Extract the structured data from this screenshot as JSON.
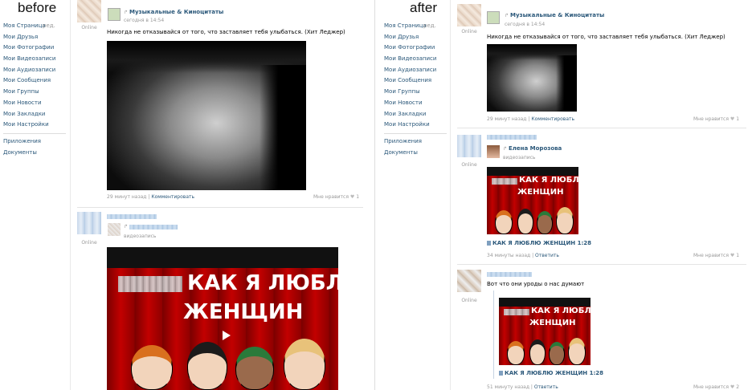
{
  "captions": {
    "before": "before",
    "after": "after"
  },
  "sidebar": {
    "items": [
      "Моя Страница",
      "Мои Друзья",
      "Мои Фотографии",
      "Мои Видеозаписи",
      "Мои Аудиозаписи",
      "Мои Сообщения",
      "Мои Группы",
      "Мои Новости",
      "Мои Закладки",
      "Мои Настройки"
    ],
    "edit": "ред.",
    "extra": [
      "Приложения",
      "Документы"
    ]
  },
  "before": {
    "post1": {
      "online": "Online",
      "group": "Музыкальные & Киноцитаты",
      "time": "сегодня в 14:54",
      "text": "Никогда не отказывайся от того, что заставляет тебя улыбаться. (Хит Леджер)",
      "footer_time": "29 минут назад",
      "footer_sep": " | ",
      "footer_link": "Комментировать",
      "likes": "Мне нравится",
      "likes_count": "1"
    },
    "post2": {
      "online": "Online",
      "sub": "видеозапись",
      "video_title1": "КАК Я ЛЮБЛЮ",
      "video_title2": "ЖЕНЩИН"
    }
  },
  "after": {
    "post1": {
      "online": "Online",
      "group": "Музыкальные & Киноцитаты",
      "time": "сегодня в 14:54",
      "text": "Никогда не отказывайся от того, что заставляет тебя улыбаться. (Хит Леджер)",
      "footer_time": "29 минут назад",
      "footer_sep": " | ",
      "footer_link": "Комментировать",
      "likes": "Мне нравится",
      "likes_count": "1"
    },
    "post2": {
      "online": "Online",
      "author": "Елена Морозова",
      "sub": "видеозапись",
      "video_title1": "КАК Я ЛЮБЛЮ",
      "video_title2": "ЖЕНЩИН",
      "video_link": "КАК Я ЛЮБЛЮ ЖЕНЩИН 1:28",
      "footer_time": "34 минуты назад",
      "footer_sep": " | ",
      "footer_link": "Ответить",
      "likes": "Мне нравится",
      "likes_count": "1"
    },
    "post3": {
      "online": "Online",
      "text": "Вот что они уроды о нас думают",
      "video_title1": "КАК Я ЛЮБЛЮ",
      "video_title2": "ЖЕНЩИН",
      "video_link": "КАК Я ЛЮБЛЮ ЖЕНЩИН 1:28",
      "footer_time": "51 минуту назад",
      "footer_sep": " | ",
      "footer_link": "Ответить",
      "likes": "Мне нравится",
      "likes_count": "2"
    }
  },
  "colors": {
    "link": "#2b587a",
    "muted": "#999999"
  },
  "icons": [
    "heart-icon",
    "video-icon",
    "repost-icon",
    "play-icon"
  ]
}
